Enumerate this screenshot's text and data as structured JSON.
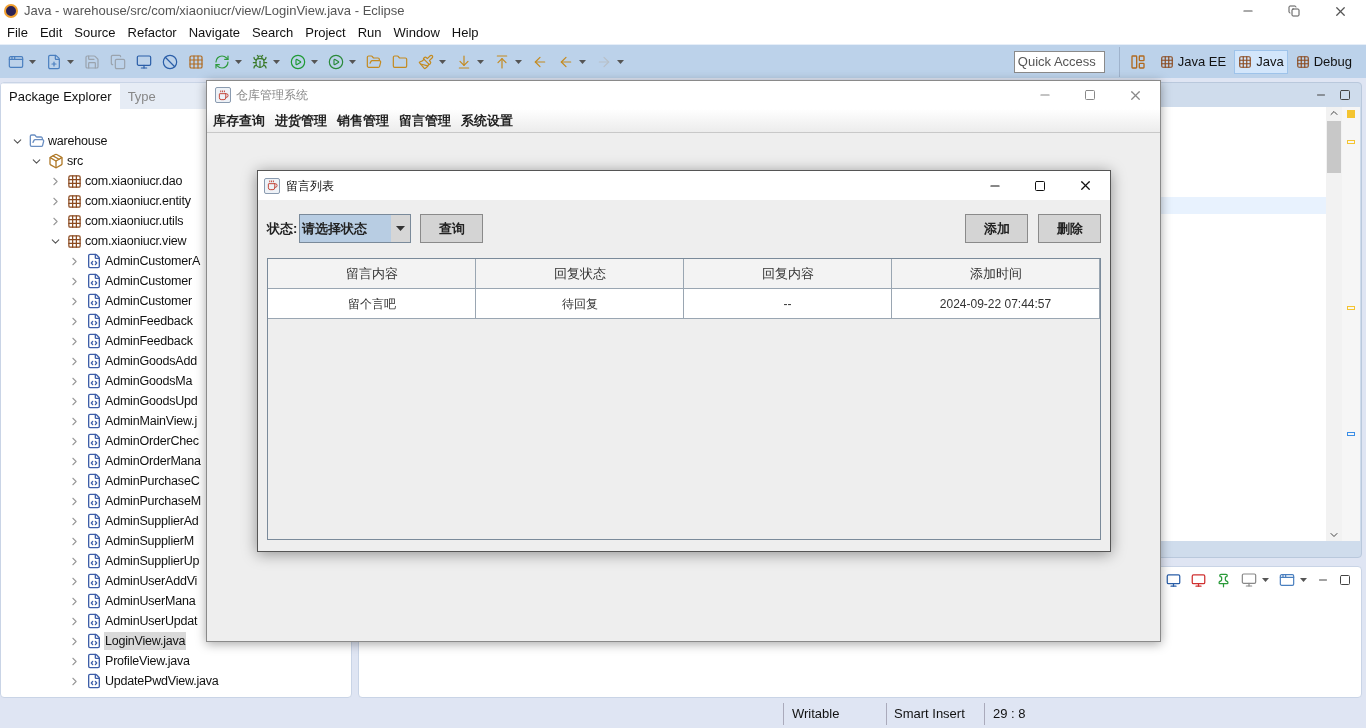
{
  "window": {
    "title": "Java - warehouse/src/com/xiaoniucr/view/LoginView.java - Eclipse"
  },
  "menu": [
    "File",
    "Edit",
    "Source",
    "Refactor",
    "Navigate",
    "Search",
    "Project",
    "Run",
    "Window",
    "Help"
  ],
  "quick_access": {
    "placeholder": "Quick Access"
  },
  "perspectives": [
    {
      "label": "Java EE",
      "selected": false
    },
    {
      "label": "Java",
      "selected": true
    },
    {
      "label": "Debug",
      "selected": false
    }
  ],
  "views": [
    {
      "label": "Package Explorer",
      "selected": true
    },
    {
      "label": "Type",
      "selected": false
    }
  ],
  "tree": [
    {
      "label": "warehouse",
      "kind": "project",
      "expanded": true,
      "selected": false,
      "children": [
        {
          "label": "src",
          "kind": "folder",
          "expanded": true,
          "selected": false,
          "children": [
            {
              "label": "com.xiaoniucr.dao",
              "kind": "package",
              "expanded": false,
              "selected": false
            },
            {
              "label": "com.xiaoniucr.entity",
              "kind": "package",
              "expanded": false,
              "selected": false
            },
            {
              "label": "com.xiaoniucr.utils",
              "kind": "package",
              "expanded": false,
              "selected": false
            },
            {
              "label": "com.xiaoniucr.view",
              "kind": "package",
              "expanded": true,
              "selected": false,
              "children": [
                {
                  "label": "AdminCustomerA",
                  "kind": "file",
                  "expanded": false,
                  "selected": false
                },
                {
                  "label": "AdminCustomer",
                  "kind": "file",
                  "expanded": false,
                  "selected": false
                },
                {
                  "label": "AdminCustomer",
                  "kind": "file",
                  "expanded": false,
                  "selected": false
                },
                {
                  "label": "AdminFeedback",
                  "kind": "file",
                  "expanded": false,
                  "selected": false
                },
                {
                  "label": "AdminFeedback",
                  "kind": "file",
                  "expanded": false,
                  "selected": false
                },
                {
                  "label": "AdminGoodsAdd",
                  "kind": "file",
                  "expanded": false,
                  "selected": false
                },
                {
                  "label": "AdminGoodsMa",
                  "kind": "file",
                  "expanded": false,
                  "selected": false
                },
                {
                  "label": "AdminGoodsUpd",
                  "kind": "file",
                  "expanded": false,
                  "selected": false
                },
                {
                  "label": "AdminMainView.j",
                  "kind": "file",
                  "expanded": false,
                  "selected": false
                },
                {
                  "label": "AdminOrderChec",
                  "kind": "file",
                  "expanded": false,
                  "selected": false
                },
                {
                  "label": "AdminOrderMana",
                  "kind": "file",
                  "expanded": false,
                  "selected": false
                },
                {
                  "label": "AdminPurchaseC",
                  "kind": "file",
                  "expanded": false,
                  "selected": false
                },
                {
                  "label": "AdminPurchaseM",
                  "kind": "file",
                  "expanded": false,
                  "selected": false
                },
                {
                  "label": "AdminSupplierAd",
                  "kind": "file",
                  "expanded": false,
                  "selected": false
                },
                {
                  "label": "AdminSupplierM",
                  "kind": "file",
                  "expanded": false,
                  "selected": false
                },
                {
                  "label": "AdminSupplierUp",
                  "kind": "file",
                  "expanded": false,
                  "selected": false
                },
                {
                  "label": "AdminUserAddVi",
                  "kind": "file",
                  "expanded": false,
                  "selected": false
                },
                {
                  "label": "AdminUserMana",
                  "kind": "file",
                  "expanded": false,
                  "selected": false
                },
                {
                  "label": "AdminUserUpdat",
                  "kind": "file",
                  "expanded": false,
                  "selected": false
                },
                {
                  "label": "LoginView.java",
                  "kind": "file",
                  "expanded": false,
                  "selected": true
                },
                {
                  "label": "ProfileView.java",
                  "kind": "file",
                  "expanded": false,
                  "selected": false
                },
                {
                  "label": "UpdatePwdView.java",
                  "kind": "file",
                  "expanded": false,
                  "selected": false
                }
              ]
            }
          ]
        }
      ]
    }
  ],
  "status_bar": [
    "Writable",
    "Smart Insert",
    "29 : 8"
  ],
  "app_window": {
    "title": "仓库管理系统",
    "menu": [
      "库存查询",
      "进货管理",
      "销售管理",
      "留言管理",
      "系统设置"
    ]
  },
  "dialog": {
    "title": "留言列表",
    "filter_label": "状态:",
    "status_select": {
      "value": "请选择状态"
    },
    "query_button": "查询",
    "actions": [
      "添加",
      "删除"
    ],
    "table": {
      "columns": [
        "留言内容",
        "回复状态",
        "回复内容",
        "添加时间"
      ],
      "rows": [
        [
          "留个言吧",
          "待回复",
          "--",
          "2024-09-22 07:44:57"
        ]
      ]
    }
  }
}
